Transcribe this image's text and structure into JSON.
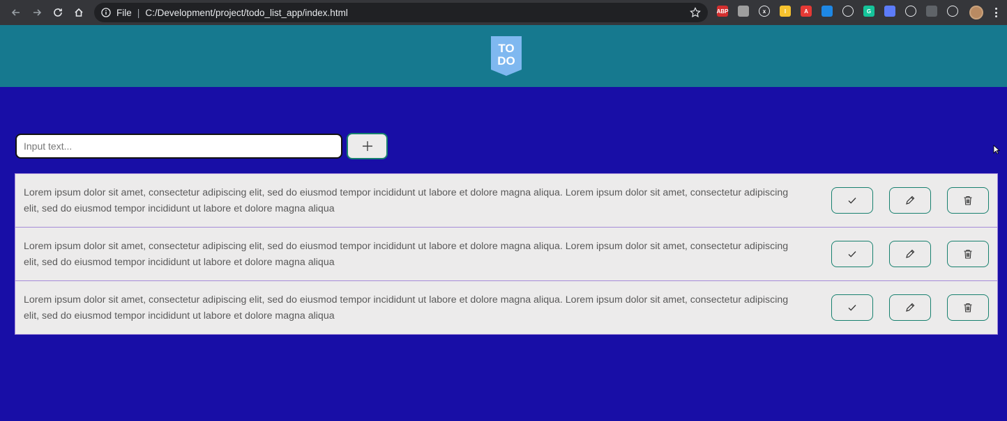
{
  "browser": {
    "file_label": "File",
    "url": "C:/Development/project/todo_list_app/index.html",
    "nav_icons": [
      "back-icon",
      "forward-icon",
      "reload-icon",
      "home-icon"
    ],
    "extensions": [
      {
        "name": "adblock-plus-icon",
        "label": "ABP",
        "color": "#d32f2f"
      },
      {
        "name": "pdf-icon",
        "label": "",
        "color": "#9e9e9e"
      },
      {
        "name": "x-extension-icon",
        "label": "x",
        "color": "#35363a"
      },
      {
        "name": "l-extension-icon",
        "label": "l",
        "color": "#f6c22e"
      },
      {
        "name": "angular-icon",
        "label": "A",
        "color": "#e53935"
      },
      {
        "name": "cloud-app-icon",
        "label": "",
        "color": "#1e88e5"
      },
      {
        "name": "onedrive-icon",
        "label": "",
        "color": "#35363a"
      },
      {
        "name": "grammarly-icon",
        "label": "G",
        "color": "#15c39a"
      },
      {
        "name": "window-extension-icon",
        "label": "",
        "color": "#5c7cfa"
      },
      {
        "name": "magnet-icon",
        "label": "",
        "color": "#35363a"
      },
      {
        "name": "shield-extension-icon",
        "label": "",
        "color": "#5f6368"
      },
      {
        "name": "puzzle-icon",
        "label": "",
        "color": "#35363a"
      }
    ]
  },
  "header": {
    "logo_text_top": "TO",
    "logo_text_bottom": "DO"
  },
  "input": {
    "placeholder": "Input text...",
    "value": ""
  },
  "add_button": {
    "icon": "plus-icon"
  },
  "todos": [
    {
      "text": "Lorem ipsum dolor sit amet, consectetur adipiscing elit, sed do eiusmod tempor incididunt ut labore et dolore magna aliqua. Lorem ipsum dolor sit amet, consectetur adipiscing elit, sed do eiusmod tempor incididunt ut labore et dolore magna aliqua"
    },
    {
      "text": "Lorem ipsum dolor sit amet, consectetur adipiscing elit, sed do eiusmod tempor incididunt ut labore et dolore magna aliqua. Lorem ipsum dolor sit amet, consectetur adipiscing elit, sed do eiusmod tempor incididunt ut labore et dolore magna aliqua"
    },
    {
      "text": "Lorem ipsum dolor sit amet, consectetur adipiscing elit, sed do eiusmod tempor incididunt ut labore et dolore magna aliqua. Lorem ipsum dolor sit amet, consectetur adipiscing elit, sed do eiusmod tempor incididunt ut labore et dolore magna aliqua"
    }
  ],
  "colors": {
    "page_background": "#180ea6",
    "header_background": "#16798f",
    "accent_border": "#17806e",
    "list_background": "#ecebeb",
    "row_divider": "#a48ad8"
  }
}
